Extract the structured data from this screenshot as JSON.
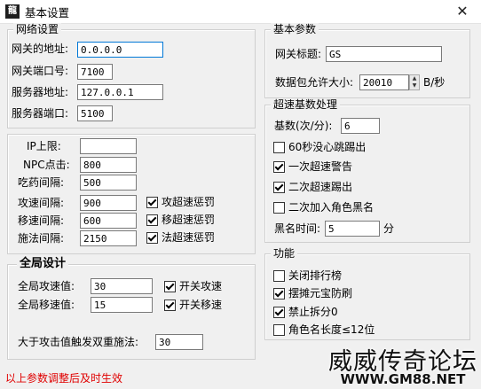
{
  "window": {
    "title": "基本设置",
    "icon_text": "龍",
    "close": "✕"
  },
  "network": {
    "title": "网络设置",
    "gateway_addr_label": "网关的地址:",
    "gateway_addr": "0.0.0.0",
    "gateway_port_label": "网关端口号:",
    "gateway_port": "7100",
    "server_addr_label": "服务器地址:",
    "server_addr": "127.0.0.1",
    "server_port_label": "服务器端口:",
    "server_port": "5100"
  },
  "limits": {
    "ip_label": "IP上限:",
    "ip_value": "",
    "npc_label": "NPC点击:",
    "npc_value": "800",
    "drug_label": "吃药间隔:",
    "drug_value": "500",
    "attack_label": "攻速间隔:",
    "attack_value": "900",
    "attack_cb": "攻超速惩罚",
    "move_label": "移速间隔:",
    "move_value": "600",
    "move_cb": "移超速惩罚",
    "spell_label": "施法间隔:",
    "spell_value": "2150",
    "spell_cb": "法超速惩罚"
  },
  "global": {
    "title": "全局设计",
    "attack_label": "全局攻速值:",
    "attack_value": "30",
    "attack_cb": "开关攻速",
    "move_label": "全局移速值:",
    "move_value": "15",
    "move_cb": "开关移速",
    "double_label": "大于攻击值触发双重施法:",
    "double_value": "30"
  },
  "basic_params": {
    "title": "基本参数",
    "gateway_title_label": "网关标题:",
    "gateway_title": "GS",
    "packet_label": "数据包允许大小:",
    "packet_value": "20010",
    "packet_unit": "B/秒"
  },
  "overspeed": {
    "title": "超速基数处理",
    "base_label": "基数(次/分):",
    "base_value": "6",
    "cb1": "60秒没心跳踢出",
    "cb2": "一次超速警告",
    "cb3": "二次超速踢出",
    "cb4": "二次加入角色黑名",
    "blacklist_label": "黑名时间:",
    "blacklist_value": "5",
    "blacklist_unit": "分"
  },
  "functions": {
    "title": "功能",
    "cb1": "关闭排行榜",
    "cb2": "摆摊元宝防刷",
    "cb3": "禁止拆分0",
    "cb4": "角色名长度≤12位"
  },
  "footer": {
    "note": "以上参数调整后及时生效"
  },
  "watermark": {
    "text": "威威传奇论坛",
    "url": "WWW.GM88.NET"
  }
}
